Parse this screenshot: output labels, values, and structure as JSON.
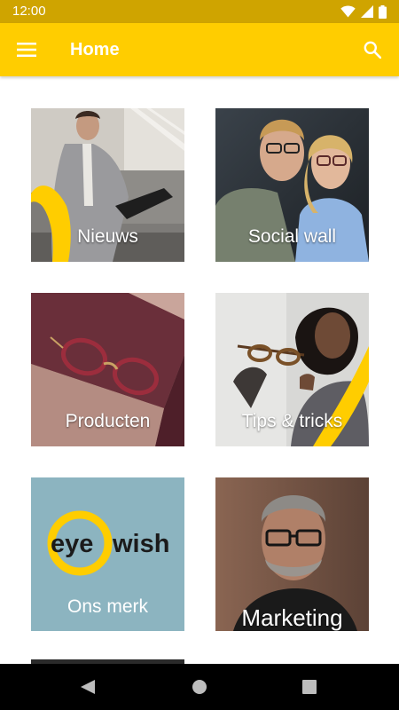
{
  "status_bar": {
    "time": "12:00",
    "icons": [
      "wifi-icon",
      "signal-icon",
      "battery-icon"
    ]
  },
  "app_bar": {
    "title": "Home",
    "menu_icon": "hamburger-menu-icon",
    "search_icon": "search-icon",
    "background_color": "#ffcd00"
  },
  "tiles": [
    {
      "label": "Nieuws"
    },
    {
      "label": "Social wall"
    },
    {
      "label": "Producten"
    },
    {
      "label": "Tips & tricks"
    },
    {
      "label": "Ons merk",
      "logo": {
        "part1": "eye",
        "part2": "wish"
      }
    },
    {
      "label": "Marketing"
    }
  ],
  "nav_bar": {
    "icons": [
      "back-icon",
      "home-icon",
      "recents-icon"
    ]
  },
  "colors": {
    "accent": "#ffcd00",
    "status_bar": "#cfa400",
    "brand_tile_bg": "#8cb4c0"
  }
}
